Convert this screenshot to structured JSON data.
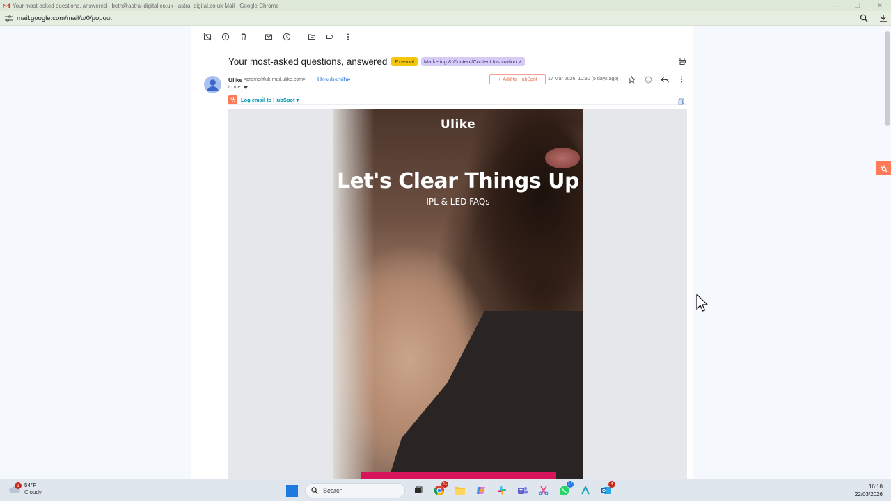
{
  "window": {
    "title": "Your most-asked questions, answered - beth@astral-digital.co.uk - astral-digital.co.uk Mail - Google Chrome",
    "url": "mail.google.com/mail/u/0/popout"
  },
  "email": {
    "subject": "Your most-asked questions, answered",
    "labels": [
      "External",
      "Marketing & Content/Content Inspiration"
    ],
    "sender_name": "Ulike",
    "sender_email": "<promo@uk-mail.ulike.com>",
    "unsubscribe": "Unsubscribe",
    "to": "to me",
    "add_to_hubspot": "Add to HubSpot",
    "date": "17 Mar 2026, 10:30 (5 days ago)",
    "log_email": "Log email to HubSpot"
  },
  "body": {
    "brand": "Ulike",
    "headline": "Let's Clear Things Up",
    "subheadline": "IPL & LED FAQs"
  },
  "taskbar": {
    "temperature": "54°F",
    "condition": "Cloudy",
    "weather_badge": "1",
    "search_label": "Search",
    "chrome_badge": "41",
    "whatsapp_badge": "17",
    "outlook_badge": "4",
    "time": "16:18",
    "date": "22/03/2026"
  },
  "colors": {
    "hubspot": "#ff7a59",
    "external_label": "#f4c70d",
    "marketing_label": "#d6cbf4",
    "cta": "#d8145b",
    "link": "#1a6fd1"
  }
}
